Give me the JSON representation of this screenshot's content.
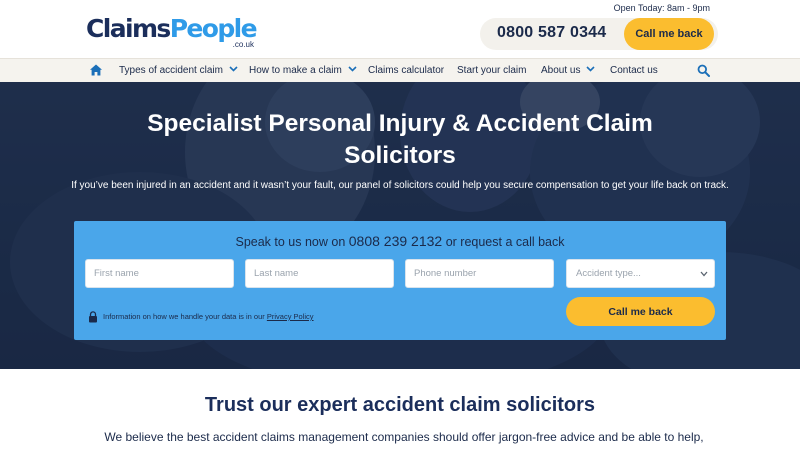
{
  "brand": {
    "logo_claims": "Claims",
    "logo_people": "People",
    "logo_tld": ".co.uk",
    "primary_color": "#1b2e5b",
    "accent_color": "#2f9be8",
    "cta_color": "#fbbd2f"
  },
  "header": {
    "open_today": "Open Today: 8am - 9pm",
    "phone": "0800 587 0344",
    "callback_label": "Call me back"
  },
  "nav": {
    "home_icon": "home-icon",
    "items": [
      {
        "label": "Types of accident claim",
        "dropdown": true
      },
      {
        "label": "How to make a claim",
        "dropdown": true
      },
      {
        "label": "Claims calculator",
        "dropdown": false
      },
      {
        "label": "Start your claim",
        "dropdown": false
      },
      {
        "label": "About us",
        "dropdown": true
      },
      {
        "label": "Contact us",
        "dropdown": false
      }
    ],
    "search_icon": "search-icon"
  },
  "hero": {
    "title": "Specialist Personal Injury & Accident Claim Solicitors",
    "subtitle": "If you’ve been injured in an accident and it wasn’t your fault, our panel of solicitors could help you secure compensation to get your life back on track."
  },
  "form": {
    "heading_prefix": "Speak to us now on",
    "heading_phone": "0808 239 2132",
    "heading_suffix": "or request a call back",
    "first_name_placeholder": "First name",
    "last_name_placeholder": "Last name",
    "phone_placeholder": "Phone number",
    "accident_type_placeholder": "Accident type...",
    "privacy_text": "Information on how we handle your data is in our",
    "privacy_link": "Privacy Policy",
    "submit_label": "Call me back",
    "panel_color": "#4aa6ea"
  },
  "trust": {
    "title": "Trust our expert accident claim solicitors",
    "text": "We believe the best accident claims management companies should offer jargon-free advice and be able to help, regardless"
  }
}
